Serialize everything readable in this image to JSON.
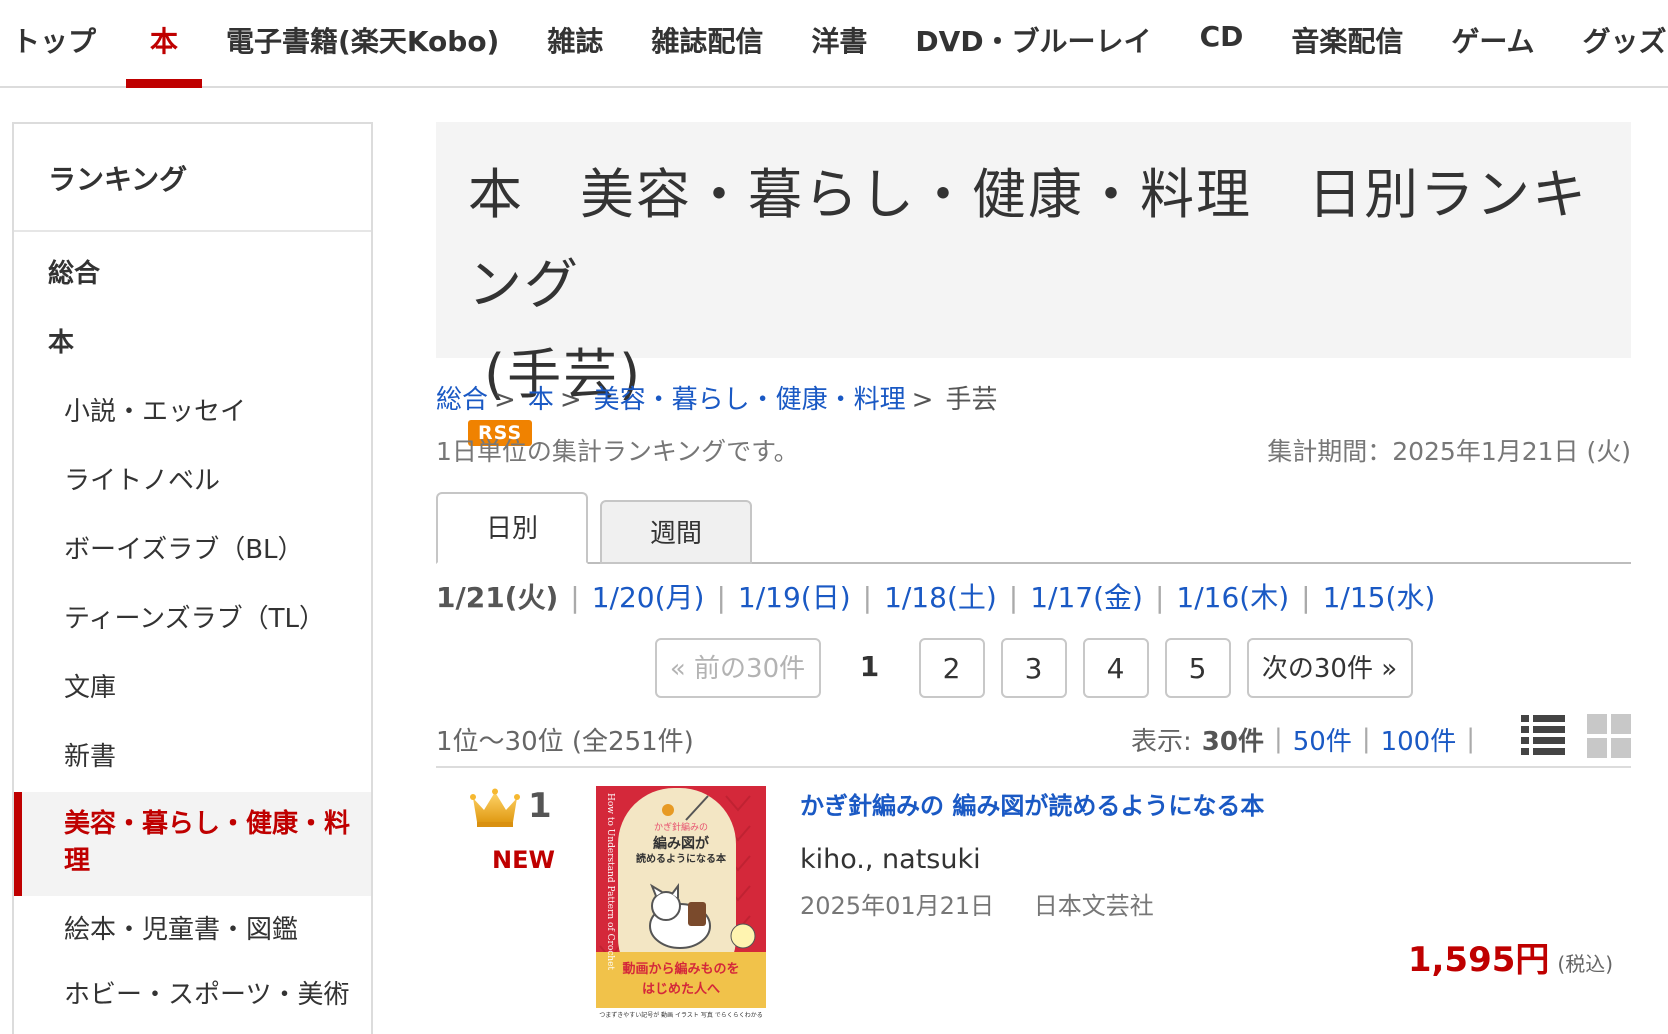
{
  "topnav": {
    "items": [
      {
        "label": "トップ"
      },
      {
        "label": "本"
      },
      {
        "label": "電子書籍(楽天Kobo)"
      },
      {
        "label": "雑誌"
      },
      {
        "label": "雑誌配信"
      },
      {
        "label": "洋書"
      },
      {
        "label": "DVD・ブルーレイ"
      },
      {
        "label": "CD"
      },
      {
        "label": "音楽配信"
      },
      {
        "label": "ゲーム"
      },
      {
        "label": "グッズ"
      }
    ],
    "active_index": 1
  },
  "sidebar": {
    "title": "ランキング",
    "items": [
      {
        "label": "総合"
      },
      {
        "label": "本"
      },
      {
        "label": "小説・エッセイ"
      },
      {
        "label": "ライトノベル"
      },
      {
        "label": "ボーイズラブ（BL）"
      },
      {
        "label": "ティーンズラブ（TL）"
      },
      {
        "label": "文庫"
      },
      {
        "label": "新書"
      },
      {
        "label": "美容・暮らし・健康・料理"
      },
      {
        "label": "絵本・児童書・図鑑"
      },
      {
        "label": "ホビー・スポーツ・美術"
      }
    ]
  },
  "header": {
    "title_line1": "本　美容・暮らし・健康・料理　日別ランキング",
    "title_line2": "(手芸)",
    "rss": "RSS"
  },
  "breadcrumb": {
    "items": [
      "総合",
      "本",
      "美容・暮らし・健康・料理"
    ],
    "separator": ">",
    "current": "手芸"
  },
  "info": {
    "description": "1日単位の集計ランキングです。",
    "period": "集計期間：2025年1月21日 (火)"
  },
  "tabs": {
    "daily": "日別",
    "weekly": "週間"
  },
  "dates": {
    "current": "1/21(火)",
    "links": [
      "1/20(月)",
      "1/19(日)",
      "1/18(土)",
      "1/17(金)",
      "1/16(木)",
      "1/15(水)"
    ],
    "separator": "|"
  },
  "pager": {
    "prev": "« 前の30件",
    "current": "1",
    "pages": [
      "2",
      "3",
      "4",
      "5"
    ],
    "next": "次の30件 »"
  },
  "listing": {
    "range": "1位〜30位 (全251件)",
    "display_label": "表示:",
    "display_selected": "30件",
    "display_options": [
      "50件",
      "100件"
    ],
    "separator": "|",
    "view_list_icon": "list-view-icon",
    "view_grid_icon": "grid-view-icon"
  },
  "items": [
    {
      "rank": "1",
      "badge": "NEW",
      "title": "かぎ針編みの 編み図が読めるようになる本",
      "author": "kiho., natsuki",
      "date": "2025年01月21日",
      "publisher": "日本文芸社",
      "price": "1,595円",
      "tax": "(税込)",
      "cover": {
        "spine_text": "How to Understand Pattern of Crochet",
        "top_text": "かぎ針編みの",
        "main_title_1": "編み図が",
        "main_title_2": "読めるようになる本",
        "band_1": "動画から編みものを",
        "band_2": "はじめた人へ",
        "footer": "つまずきやすい記号が 動画 イラスト 写真 でらくらくわかる",
        "colors": {
          "red": "#d4283a",
          "cream": "#f3e6c4",
          "band": "#f1c24a"
        }
      }
    }
  ]
}
